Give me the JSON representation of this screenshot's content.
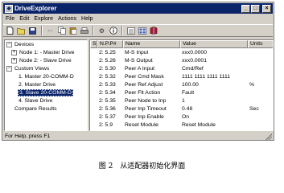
{
  "window": {
    "title": "DriveExplorer",
    "buttons": {
      "minimize": "_",
      "maximize": "□",
      "close": "×"
    }
  },
  "menu": [
    "File",
    "Edit",
    "Explore",
    "Actions",
    "Help"
  ],
  "toolbar": {
    "icons": [
      "new-file-icon",
      "open-folder-icon",
      "save-icon",
      "cut-icon",
      "copy-icon",
      "paste-icon",
      "print-icon",
      "connect-icon",
      "info-icon",
      "list-view-icon",
      "details-view-icon",
      "book-icon"
    ]
  },
  "tree": [
    {
      "label": "Devices",
      "expander": "−",
      "level": 0,
      "selected": false
    },
    {
      "label": "Node 1: - Master Drive",
      "expander": "+",
      "level": 1,
      "selected": false
    },
    {
      "label": "Node 2: - Slave Drive",
      "expander": "+",
      "level": 1,
      "selected": false
    },
    {
      "label": "Custom Views",
      "expander": "−",
      "level": 0,
      "selected": false
    },
    {
      "label": "1. Master 20-COMM-D",
      "expander": "",
      "level": 1,
      "selected": false
    },
    {
      "label": "2. Master Drive",
      "expander": "",
      "level": 1,
      "selected": false
    },
    {
      "label": "3. Slave 20-COMM-D",
      "expander": "",
      "level": 1,
      "selected": true
    },
    {
      "label": "4. Slave Drive",
      "expander": "",
      "level": 1,
      "selected": false
    },
    {
      "label": "Compare Results",
      "expander": "",
      "level": 0,
      "selected": false
    }
  ],
  "list": {
    "columns": [
      "S",
      "N.P.P#",
      "Name",
      "Value",
      "Units"
    ],
    "rows": [
      [
        "",
        "2: 5.25",
        "M-S Input",
        "xxx0.0000",
        ""
      ],
      [
        "",
        "2: 5.26",
        "M-S Output",
        "xxx0.0001",
        ""
      ],
      [
        "",
        "2: 5.30",
        "Peer A Input",
        "Cmd/Ref",
        ""
      ],
      [
        "",
        "2: 5.32",
        "Peer Cmd Mask",
        "1111 1111 1111 1111",
        ""
      ],
      [
        "",
        "2: 5.33",
        "Peer Ref Adjust",
        "100.00",
        "%"
      ],
      [
        "",
        "2: 5.34",
        "Peer Flt Action",
        "Fault",
        ""
      ],
      [
        "",
        "2: 5.35",
        "Peer Node to Inp",
        "1",
        ""
      ],
      [
        "",
        "2: 5.36",
        "Peer Inp Timeout",
        "0.48",
        "Sec"
      ],
      [
        "",
        "2: 5.37",
        "Peer Inp Enable",
        "On",
        ""
      ],
      [
        "",
        "2: 5.9",
        "Reset Module",
        "Reset Module",
        ""
      ]
    ]
  },
  "status": {
    "text": "For Help, press F1"
  },
  "caption": "图 2　从适配器初始化界面"
}
